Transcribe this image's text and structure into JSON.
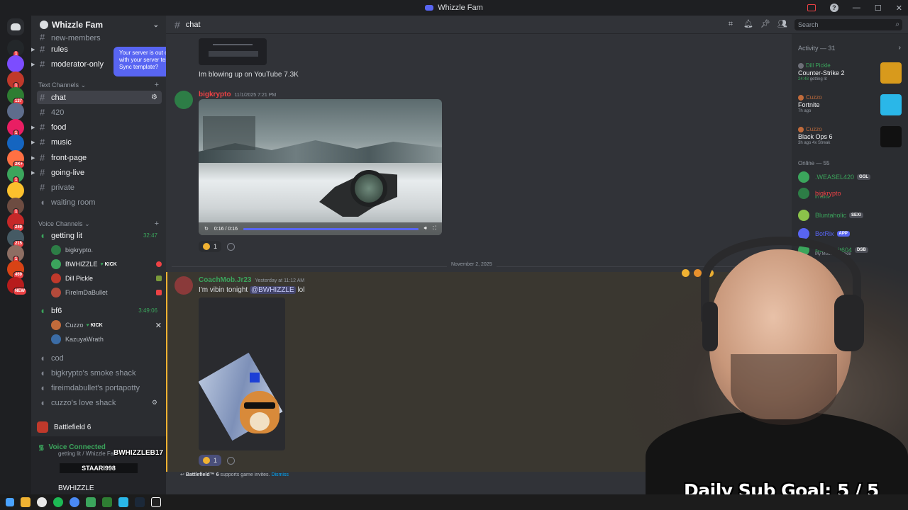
{
  "window": {
    "title": "Whizzle Fam"
  },
  "colors": {
    "accent": "#5865f2",
    "online": "#3ba55c",
    "mention": "#f0b232",
    "danger": "#ed4245"
  },
  "servers": [
    {
      "badge": "1"
    },
    {
      "badge": ""
    },
    {
      "badge": "1"
    },
    {
      "badge": "137"
    },
    {
      "badge": ""
    },
    {
      "badge": "1"
    },
    {
      "badge": ""
    },
    {
      "badge": "2K+"
    },
    {
      "badge": "1"
    },
    {
      "badge": ""
    },
    {
      "badge": "1"
    },
    {
      "badge": "249"
    },
    {
      "badge": "215"
    },
    {
      "badge": "1"
    },
    {
      "badge": "469"
    },
    {
      "badge": "NEW"
    }
  ],
  "sidebar": {
    "guild_name": "Whizzle Fam",
    "tooltip": "Your server is out of sync with your server template. Sync template?",
    "channels_top": [
      {
        "label": "new-members"
      },
      {
        "label": "rules"
      },
      {
        "label": "moderator-only"
      }
    ],
    "text_category": "Text Channels",
    "text_channels": [
      {
        "label": "chat"
      },
      {
        "label": "420"
      },
      {
        "label": "food"
      },
      {
        "label": "music"
      },
      {
        "label": "front-page"
      },
      {
        "label": "going-live"
      },
      {
        "label": "private"
      },
      {
        "label": "waiting room"
      }
    ],
    "voice_category": "Voice Channels",
    "voice_channels": [
      {
        "label": "getting lit",
        "timer": "32:47"
      },
      {
        "label": "bf6",
        "timer": "3:49:06"
      },
      {
        "label": "cod"
      },
      {
        "label": "bigkrypto's smoke shack"
      },
      {
        "label": "fireimdabullet's portapotty"
      },
      {
        "label": "cuzzo's love shack"
      }
    ],
    "voice_members_lit": [
      {
        "name": "bigkrypto."
      },
      {
        "name": "BWHIZZLE",
        "tag": "KICK"
      },
      {
        "name": "Dill Pickle"
      },
      {
        "name": "FireImDaBullet"
      }
    ],
    "voice_members_bf6": [
      {
        "name": "Cuzzo",
        "tag": "KICK"
      },
      {
        "name": "KazuyaWrath"
      }
    ],
    "game_activity": "Battlefield 6",
    "voice_status": "Voice Connected",
    "voice_sub": "getting lit / Whizzle Fam",
    "stream_overlay_name": "BWHIZZLEB17",
    "stream_overlay_banner": "STAARI998",
    "user_name": "BWHIZZLE"
  },
  "chat": {
    "channel": "chat",
    "search_placeholder": "Search",
    "msg1_text": "Im blowing up on YouTube 7.3K",
    "msg2_author": "bigkrypto",
    "msg2_time": "11/1/2025 7:21 PM",
    "video_time": "0:16 / 0:16",
    "video_progress": 1,
    "reaction1_count": "1",
    "date_divider": "November 2, 2025",
    "msg3_author": "CoachMob.Jr23",
    "msg3_time": "Yesterday at 11:12 AM",
    "msg3_text_a": "I'm vibin tonight ",
    "msg3_mention": "@BWHIZZLE",
    "msg3_text_b": " lol",
    "reaction2_count": "1",
    "invite_game": "Battlefield™ 6",
    "invite_text": " supports game invites. ",
    "invite_dismiss": "Dismiss"
  },
  "activity": {
    "header": "Activity — 31",
    "items": [
      {
        "user": "Dill Pickle",
        "game": "Counter-Strike 2",
        "time": "24:48",
        "extra": "getting lit"
      },
      {
        "user": "Cuzzo",
        "game": "Fortnite",
        "time": "7h ago"
      },
      {
        "user": "Cuzzo",
        "game": "Black Ops 6",
        "time": "3h ago",
        "extra": "4x Streak"
      }
    ],
    "online_header": "Online — 55",
    "members": [
      {
        "name": ".WEASEL420",
        "tag": "GGL",
        "color": "#3ba55c"
      },
      {
        "name": "bigkrypto",
        "sub": "In voice",
        "color": "#ed4245"
      },
      {
        "name": "Bluntaholic",
        "tag": "SEXI",
        "color": "#3ba55c"
      },
      {
        "name": "BotRix",
        "tag": "APP",
        "color": "#5865f2"
      },
      {
        "name": "Bulletbait604",
        "tag": "DSB",
        "sub": "My Moose Knuckle",
        "color": "#3ba55c"
      }
    ]
  },
  "overlay": {
    "sub_goal": "Daily Sub Goal:  5 / 5"
  }
}
